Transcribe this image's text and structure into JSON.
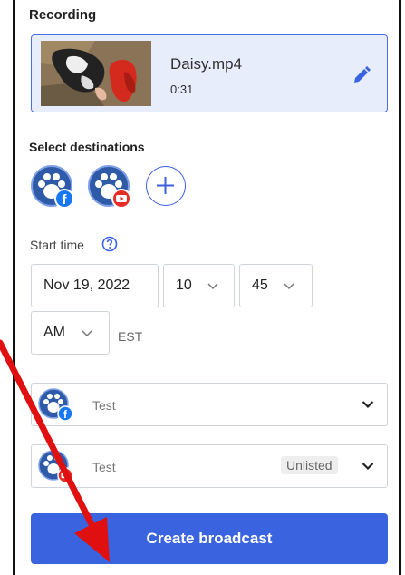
{
  "recording": {
    "title": "Recording",
    "file_name": "Daisy.mp4",
    "duration": "0:31"
  },
  "destinations": {
    "title": "Select destinations",
    "items": [
      {
        "icon": "paw-facebook-icon"
      },
      {
        "icon": "paw-youtube-icon"
      }
    ],
    "add_icon": "plus-icon"
  },
  "start_time": {
    "label": "Start time",
    "date": "Nov 19, 2022",
    "hour": "10",
    "minute": "45",
    "ampm": "AM",
    "timezone": "EST"
  },
  "accounts": [
    {
      "name": "Test",
      "platform": "facebook"
    },
    {
      "name": "Test",
      "platform": "youtube",
      "badge": "Unlisted"
    }
  ],
  "cta": {
    "label": "Create broadcast"
  },
  "colors": {
    "accent": "#3a63e0",
    "card_bg": "#e8edfc",
    "arrow": "#e01010",
    "facebook": "#1877f2",
    "youtube": "#e52d27"
  }
}
